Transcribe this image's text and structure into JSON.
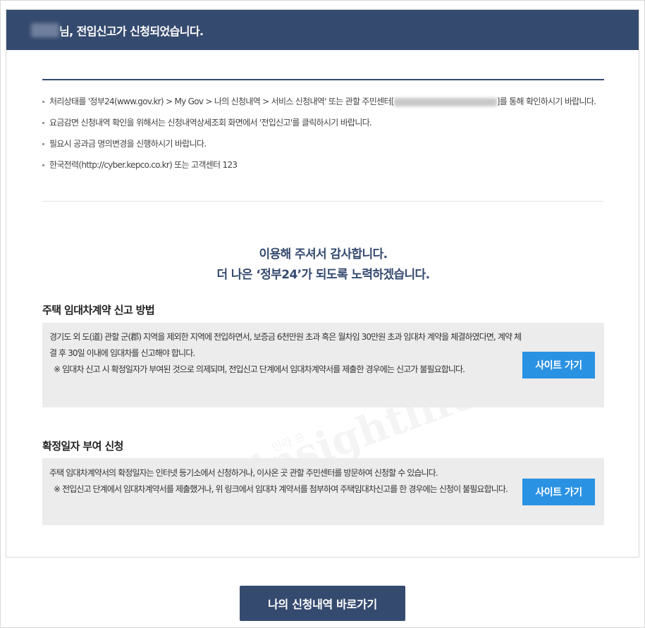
{
  "header": {
    "title": "님, 전입신고가 신청되었습니다."
  },
  "notices": [
    {
      "pre": "처리상태를 '정부24(www.gov.kr) > My Gov > 나의 신청내역 > 서비스 신청내역' 또는 관할 주민센터[",
      "post": "]를 통해 확인하시기 바랍니다."
    },
    {
      "text": "요금감면 신청내역 확인을 위해서는 신청내역상세조회 화면에서 '전입신고'를 클릭하시기 바랍니다."
    },
    {
      "text": "필요시 공과금 명의변경을 신행하시기 바랍니다."
    },
    {
      "text": "한국전력(http://cyber.kepco.co.kr) 또는 고객센터 123"
    }
  ],
  "thanks": {
    "line1": "이용해 주셔서 감사합니다.",
    "line2": "더 나은 ‘정부24’가 되도록 노력하겠습니다."
  },
  "section1": {
    "title": "주택 임대차계약 신고 방법",
    "line1": "경기도 외 도(道) 관할 군(郡) 지역을 제외한 지역에 전입하면서, 보증금 6천만원 초과 혹은 월차임 30만원 초과 임대차 계약을 체결하였다면, 계약 체결 후 30일 이내에 임대차를 신고해야 합니다.",
    "line2": "※ 임대차 신고 시 확정일자가 부여된 것으로 의제되며, 전입신고 단계에서 임대차계약서를 제출한 경우에는 신고가 불필요합니다.",
    "button": "사이트 가기"
  },
  "section2": {
    "title": "확정일자 부여 신청",
    "line1": "주택 임대차계약서의 확정일자는 인터넷 등기소에서 신청하거나, 이사온 곳 관할 주민센터를 방문하여 신청할 수 있습니다.",
    "line2": "※ 전입신고 단계에서 임대차계약서를 제출했거나, 위 링크에서 임대차 계약서를 첨부하여 주택임대차신고를 한 경우에는 신청이 불필요합니다.",
    "button": "사이트 가기"
  },
  "watermark": {
    "main": "insightlife",
    "sub": "인라 프"
  },
  "bottom_button": "나의 신청내역 바로가기"
}
